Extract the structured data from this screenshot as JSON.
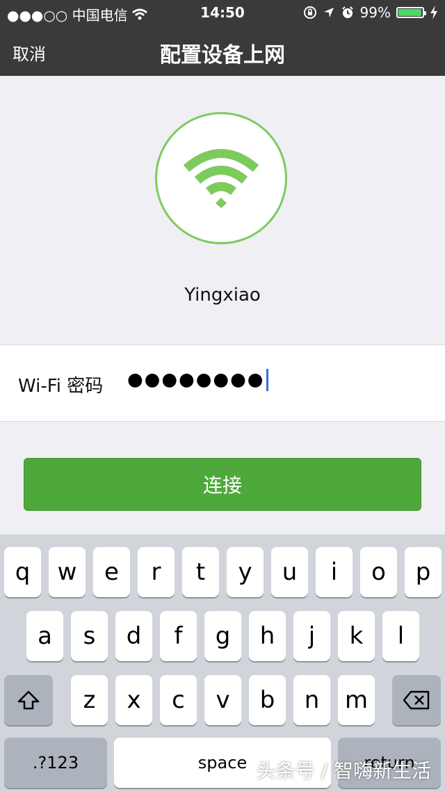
{
  "status_bar": {
    "carrier": "●●●○○ 中国电信",
    "time": "14:50",
    "battery": "99%"
  },
  "nav": {
    "cancel_label": "取消",
    "title": "配置设备上网"
  },
  "network": {
    "ssid": "Yingxiao"
  },
  "password_field": {
    "label": "Wi-Fi 密码",
    "value": "●●●●●●●●"
  },
  "connect_button": {
    "label": "连接"
  },
  "keyboard": {
    "row1": [
      "q",
      "w",
      "e",
      "r",
      "t",
      "y",
      "u",
      "i",
      "o",
      "p"
    ],
    "row2": [
      "a",
      "s",
      "d",
      "f",
      "g",
      "h",
      "j",
      "k",
      "l"
    ],
    "row3": [
      "z",
      "x",
      "c",
      "v",
      "b",
      "n",
      "m"
    ],
    "numbers_label": ".?123",
    "space_label": "space",
    "return_label": "return"
  },
  "watermark": "头条号 / 智嗨新生活",
  "colors": {
    "accent_green": "#4fa93a",
    "wifi_green": "#7dcb5d",
    "nav_bg": "#3a3a3a",
    "caret": "#2f6fe0"
  }
}
